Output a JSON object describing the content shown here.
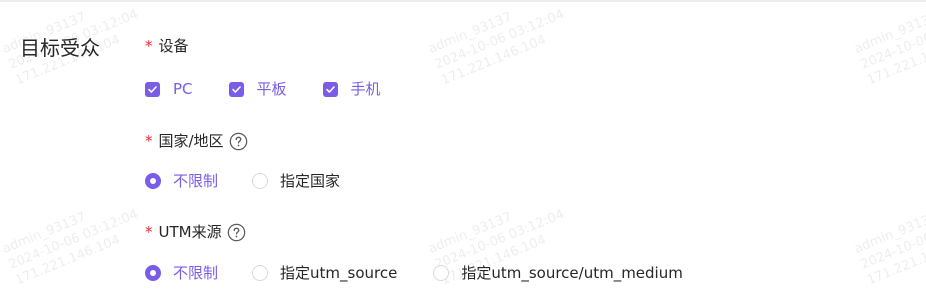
{
  "section": {
    "title": "目标受众"
  },
  "device": {
    "label": "设备",
    "options": [
      "PC",
      "平板",
      "手机"
    ],
    "checked": [
      true,
      true,
      true
    ]
  },
  "country": {
    "label": "国家/地区",
    "options": [
      "不限制",
      "指定国家"
    ],
    "selected": "不限制"
  },
  "utm": {
    "label": "UTM来源",
    "options": [
      "不限制",
      "指定utm_source",
      "指定utm_source/utm_medium"
    ],
    "selected": "不限制"
  },
  "required_mark": "*",
  "watermark": {
    "user": "admin_93137",
    "time": "2024-10-06 03:12:04",
    "ip": "171.221.146.104"
  },
  "colors": {
    "accent": "#7b5ce8",
    "required": "#f5222d"
  },
  "icons": {
    "help": "question-circle-icon",
    "check": "check-icon"
  }
}
